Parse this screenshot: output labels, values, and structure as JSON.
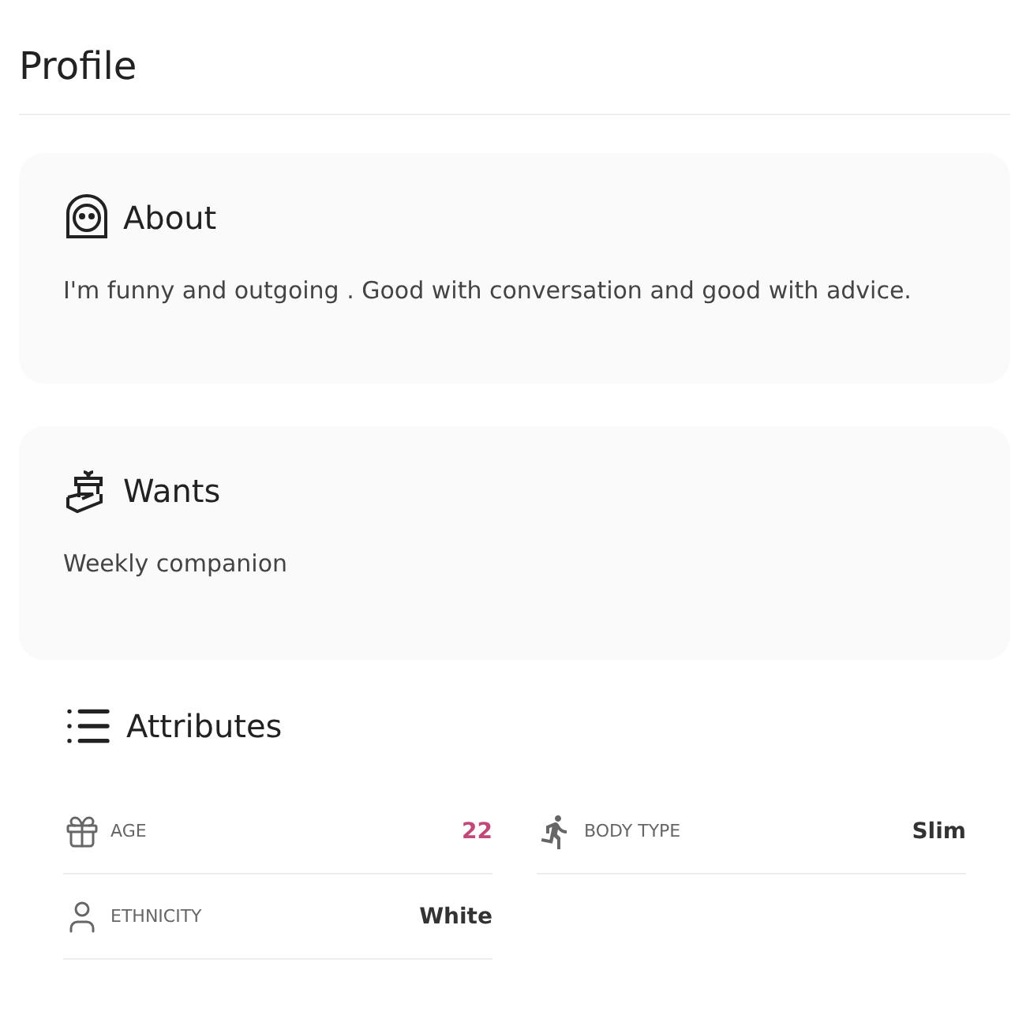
{
  "title": "Profile",
  "sections": [
    {
      "kind": "about",
      "heading": "About",
      "text": "I'm funny and outgoing . Good with conversation and good with advice."
    },
    {
      "kind": "wants",
      "heading": "Wants",
      "text": "Weekly companion"
    }
  ],
  "attributes": {
    "heading": "Attributes",
    "items": [
      {
        "kind": "age",
        "label": "AGE",
        "value": "22",
        "color": "#c2487a"
      },
      {
        "kind": "body",
        "label": "BODY TYPE",
        "value": "Slim",
        "color": "#333333"
      },
      {
        "kind": "ethnicity",
        "label": "ETHNICITY",
        "value": "White",
        "color": "#333333"
      }
    ]
  }
}
